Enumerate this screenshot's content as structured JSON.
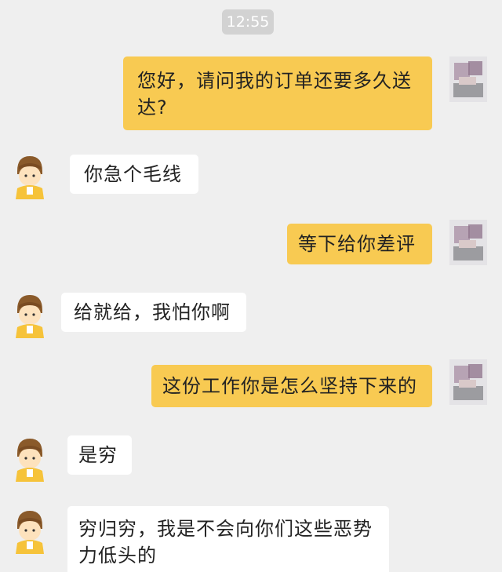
{
  "timestamp": "12:55",
  "messages": [
    {
      "side": "out",
      "text": "您好，请问我的订单还要多久送达?"
    },
    {
      "side": "in",
      "text": "你急个毛线"
    },
    {
      "side": "out",
      "text": "等下给你差评"
    },
    {
      "side": "in",
      "text": "给就给，我怕你啊"
    },
    {
      "side": "out",
      "text": "这份工作你是怎么坚持下来的"
    },
    {
      "side": "in",
      "text": "是穷"
    },
    {
      "side": "in",
      "text": "穷归穷，我是不会向你们这些恶势力低头的"
    }
  ],
  "colors": {
    "background": "#efefef",
    "outgoing_bubble": "#f8ca52",
    "incoming_bubble": "#ffffff",
    "timestamp_pill": "#d2d2d2"
  },
  "icons": {
    "user_avatar": "blurred-user-avatar-icon",
    "courier_avatar": "cartoon-courier-avatar-icon"
  }
}
